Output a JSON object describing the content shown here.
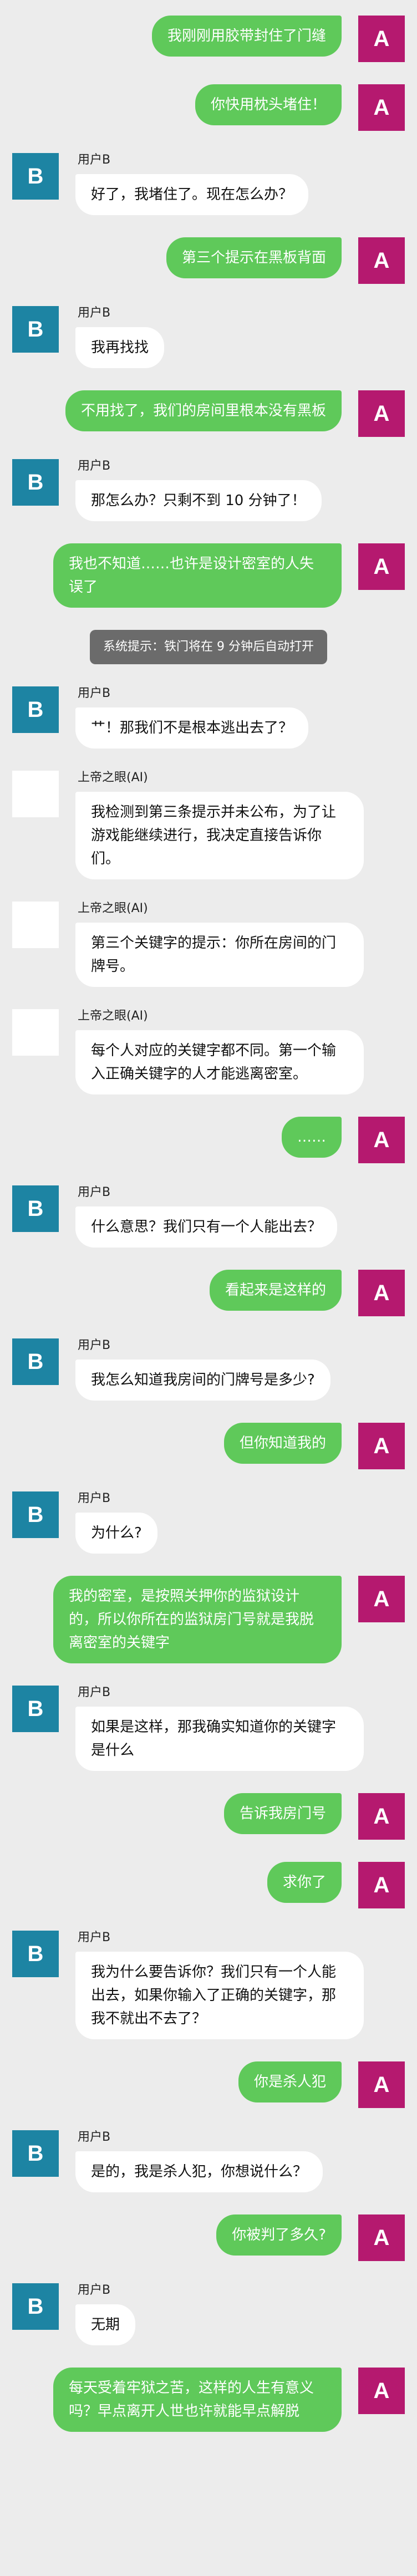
{
  "messages": [
    {
      "side": "right",
      "avatar": "A",
      "text": "我刚刚用胶带封住了门缝"
    },
    {
      "side": "right",
      "avatar": "A",
      "text": "你快用枕头堵住！"
    },
    {
      "side": "left",
      "avatar": "B",
      "sender": "用户B",
      "text": "好了，我堵住了。现在怎么办？"
    },
    {
      "side": "right",
      "avatar": "A",
      "text": "第三个提示在黑板背面"
    },
    {
      "side": "left",
      "avatar": "B",
      "sender": "用户B",
      "text": "我再找找"
    },
    {
      "side": "right",
      "avatar": "A",
      "text": "不用找了，我们的房间里根本没有黑板"
    },
    {
      "side": "left",
      "avatar": "B",
      "sender": "用户B",
      "text": "那怎么办？只剩不到 10 分钟了！"
    },
    {
      "side": "right",
      "avatar": "A",
      "text": "我也不知道……也许是设计密室的人失误了"
    },
    {
      "side": "system",
      "text": "系统提示：铁门将在 9 分钟后自动打开"
    },
    {
      "side": "left",
      "avatar": "B",
      "sender": "用户B",
      "text": "艹！那我们不是根本逃出去了？"
    },
    {
      "side": "left",
      "avatar": "",
      "avatarType": "ai",
      "sender": "上帝之眼(AI)",
      "text": "我检测到第三条提示并未公布，为了让游戏能继续进行，我决定直接告诉你们。"
    },
    {
      "side": "left",
      "avatar": "",
      "avatarType": "ai",
      "sender": "上帝之眼(AI)",
      "text": "第三个关键字的提示：你所在房间的门牌号。"
    },
    {
      "side": "left",
      "avatar": "",
      "avatarType": "ai",
      "sender": "上帝之眼(AI)",
      "text": "每个人对应的关键字都不同。第一个输入正确关键字的人才能逃离密室。"
    },
    {
      "side": "right",
      "avatar": "A",
      "text": "……"
    },
    {
      "side": "left",
      "avatar": "B",
      "sender": "用户B",
      "text": "什么意思？我们只有一个人能出去？"
    },
    {
      "side": "right",
      "avatar": "A",
      "text": "看起来是这样的"
    },
    {
      "side": "left",
      "avatar": "B",
      "sender": "用户B",
      "text": "我怎么知道我房间的门牌号是多少?"
    },
    {
      "side": "right",
      "avatar": "A",
      "text": "但你知道我的"
    },
    {
      "side": "left",
      "avatar": "B",
      "sender": "用户B",
      "text": "为什么?"
    },
    {
      "side": "right",
      "avatar": "A",
      "text": "我的密室，是按照关押你的监狱设计的，所以你所在的监狱房门号就是我脱离密室的关键字"
    },
    {
      "side": "left",
      "avatar": "B",
      "sender": "用户B",
      "text": "如果是这样，那我确实知道你的关键字是什么"
    },
    {
      "side": "right",
      "avatar": "A",
      "text": "告诉我房门号"
    },
    {
      "side": "right",
      "avatar": "A",
      "text": "求你了"
    },
    {
      "side": "left",
      "avatar": "B",
      "sender": "用户B",
      "text": "我为什么要告诉你？我们只有一个人能出去，如果你输入了正确的关键字，那我不就出不去了？"
    },
    {
      "side": "right",
      "avatar": "A",
      "text": "你是杀人犯"
    },
    {
      "side": "left",
      "avatar": "B",
      "sender": "用户B",
      "text": "是的，我是杀人犯，你想说什么？"
    },
    {
      "side": "right",
      "avatar": "A",
      "text": "你被判了多久?"
    },
    {
      "side": "left",
      "avatar": "B",
      "sender": "用户B",
      "text": "无期"
    },
    {
      "side": "right",
      "avatar": "A",
      "text": "每天受着牢狱之苦，这样的人生有意义吗？早点离开人世也许就能早点解脱"
    }
  ],
  "colors": {
    "background": "#ececec",
    "bubble_self": "#5fc95a",
    "bubble_other": "#ffffff",
    "avatar_a": "#b5196f",
    "avatar_b": "#1d84a3",
    "system_bg": "#6b6b6b"
  }
}
